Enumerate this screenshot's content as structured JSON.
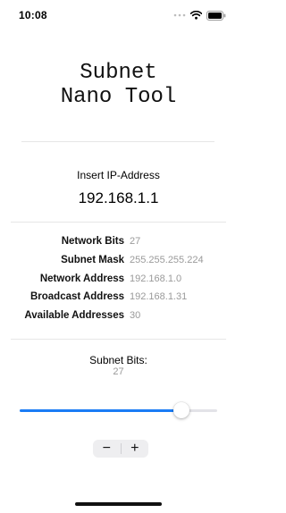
{
  "status_bar": {
    "time": "10:08",
    "icons": [
      "dots-icon",
      "wifi-icon",
      "battery-icon"
    ]
  },
  "app": {
    "title_line1": "Subnet",
    "title_line2": "Nano Tool"
  },
  "ip_input": {
    "label": "Insert IP-Address",
    "value": "192.168.1.1"
  },
  "results": [
    {
      "label": "Network Bits",
      "value": "27"
    },
    {
      "label": "Subnet Mask",
      "value": "255.255.255.224"
    },
    {
      "label": "Network Address",
      "value": "192.168.1.0"
    },
    {
      "label": "Broadcast Address",
      "value": "192.168.1.31"
    },
    {
      "label": "Available Addresses",
      "value": "30"
    }
  ],
  "subnet_bits": {
    "label": "Subnet Bits:",
    "value": "27",
    "slider_fraction": 0.82
  },
  "stepper": {
    "minus": "−",
    "plus": "+"
  },
  "colors": {
    "accent": "#1a7cf5",
    "value_gray": "#9a9a9a",
    "separator": "#e6e6e6"
  }
}
